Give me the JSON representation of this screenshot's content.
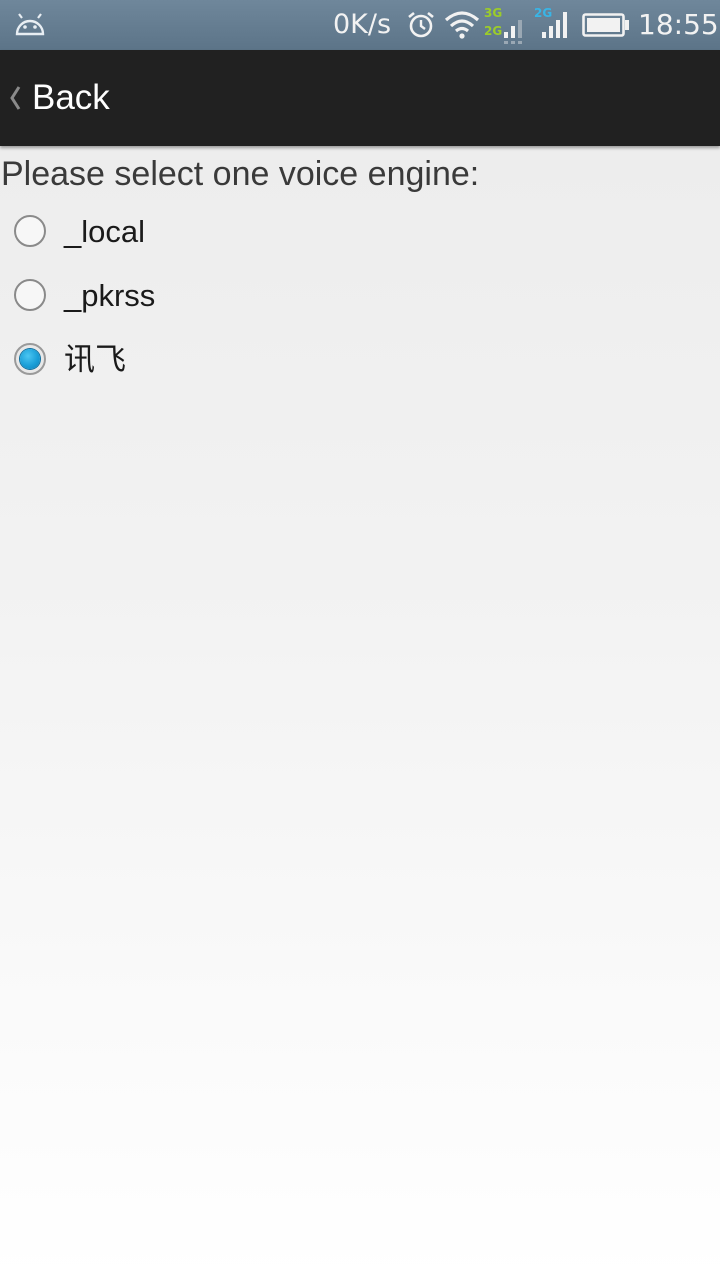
{
  "status_bar": {
    "notification_icon": "android-debug-icon",
    "net_speed": "0K/s",
    "alarm_icon": "alarm-icon",
    "wifi_icon": "wifi-icon",
    "sim1_badges": [
      "3G",
      "2G"
    ],
    "sim2_badge": "2G",
    "battery_icon": "battery-icon",
    "time": "18:55",
    "colors": {
      "badge_green": "#9ccc2a",
      "badge_blue": "#39b5e6"
    }
  },
  "action_bar": {
    "back_icon": "chevron-left-icon",
    "back_label": "Back"
  },
  "content": {
    "prompt": "Please select one voice engine:",
    "options": [
      {
        "label": "_local",
        "checked": false
      },
      {
        "label": "_pkrss",
        "checked": false
      },
      {
        "label": "讯飞",
        "checked": true
      }
    ],
    "accent_color": "#1a9fd8"
  }
}
